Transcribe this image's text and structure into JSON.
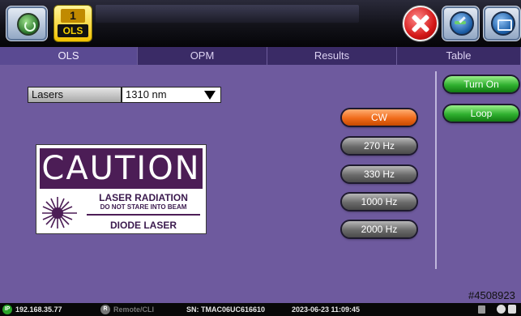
{
  "header": {
    "ols_count": "1",
    "ols_label": "OLS"
  },
  "tabs": [
    {
      "label": "OLS",
      "active": true
    },
    {
      "label": "OPM",
      "active": false
    },
    {
      "label": "Results",
      "active": false
    },
    {
      "label": "Table",
      "active": false
    }
  ],
  "lasers": {
    "label": "Lasers",
    "value": "1310 nm"
  },
  "caution_sign": {
    "title": "CAUTION",
    "line1": "LASER RADIATION",
    "line2": "DO NOT STARE INTO BEAM",
    "line3": "DIODE LASER"
  },
  "modes": [
    {
      "label": "CW",
      "selected": true
    },
    {
      "label": "270 Hz",
      "selected": false
    },
    {
      "label": "330 Hz",
      "selected": false
    },
    {
      "label": "1000 Hz",
      "selected": false
    },
    {
      "label": "2000 Hz",
      "selected": false
    }
  ],
  "actions": {
    "turn_on": "Turn On",
    "loop": "Loop"
  },
  "serial_tag": "#4508923",
  "status_bar": {
    "ip_badge": "IP",
    "ip": "192.168.35.77",
    "remote_badge": "R",
    "remote": "Remote/CLI",
    "serial": "SN: TMAC06UC616610",
    "datetime": "2023-06-23 11:09:45"
  },
  "colors": {
    "background": "#6e5a9e",
    "selected_mode": "#f06b1a",
    "action_button": "#2fb02f",
    "caution_banner": "#4c1d56"
  }
}
